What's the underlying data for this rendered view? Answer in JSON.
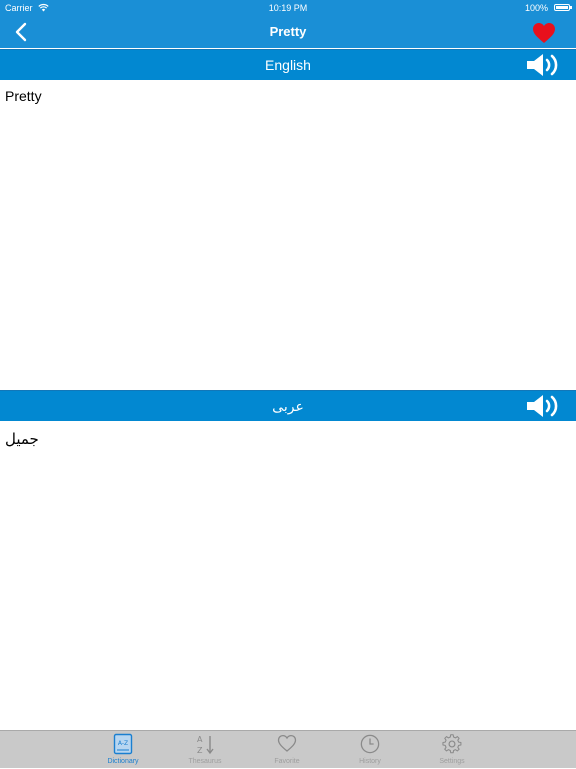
{
  "status_bar": {
    "carrier": "Carrier",
    "time": "10:19 PM",
    "battery": "100%"
  },
  "nav": {
    "title": "Pretty",
    "back_icon": "chevron-left-icon",
    "favorite_icon": "heart-icon",
    "favorite_color": "#e8101c"
  },
  "english": {
    "header": "English",
    "text": "Pretty"
  },
  "arabic": {
    "header": "عربى",
    "text": "جميل"
  },
  "tabs": [
    {
      "label": "Dictionary",
      "icon": "dictionary-book-icon",
      "active": true
    },
    {
      "label": "Thesaurus",
      "icon": "sort-az-icon",
      "active": false
    },
    {
      "label": "Favorite",
      "icon": "heart-outline-icon",
      "active": false
    },
    {
      "label": "History",
      "icon": "clock-icon",
      "active": false
    },
    {
      "label": "Settings",
      "icon": "gear-icon",
      "active": false
    }
  ],
  "colors": {
    "bar": "#1a8fd6",
    "section": "#0288d1",
    "tab_active": "#1a7fd0",
    "tab_inactive": "#9e9e9e"
  }
}
